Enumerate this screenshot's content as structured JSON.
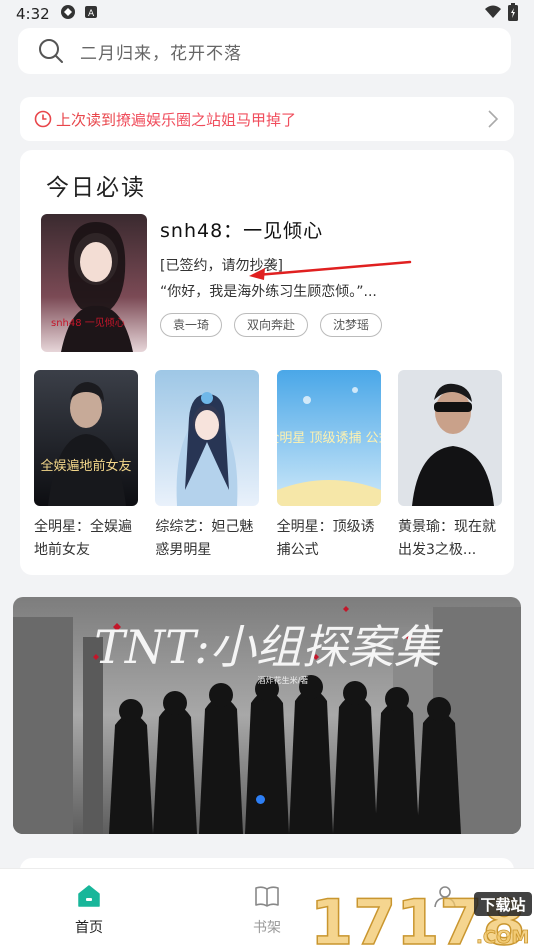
{
  "status": {
    "time": "4:32"
  },
  "search": {
    "placeholder": "二月归来，花开不落"
  },
  "last_read": {
    "prefix": "上次读到",
    "book": "撩遍娱乐圈之站姐马甲掉了"
  },
  "today": {
    "title": "今日必读",
    "feature": {
      "title": "snh48：一见倾心",
      "cover_text": "snh48 一见倾心",
      "desc1": "[已签约，请勿抄袭]",
      "desc2": "“你好，我是海外练习生顾恋倾。”...",
      "tags": [
        "袁一琦",
        "双向奔赴",
        "沈梦瑶"
      ]
    },
    "books": [
      {
        "title": "全明星：全娱遍地前女友",
        "cover_text": "全娱遍地前女友"
      },
      {
        "title": "综综艺：妲己魅惑男明星",
        "cover_text": ""
      },
      {
        "title": "全明星：顶级诱捕公式",
        "cover_text": "全明星 顶级诱捕 公式"
      },
      {
        "title": "黄景瑜：现在就出发3之极...",
        "cover_text": ""
      }
    ]
  },
  "banner": {
    "title": "TNT:小组探案集",
    "subtitle": "酒炸花生米/著"
  },
  "nav": {
    "items": [
      {
        "label": "首页"
      },
      {
        "label": "书架"
      },
      {
        "label": ""
      }
    ]
  },
  "watermark": {
    "digits": "17178",
    "site": "下载站",
    "com": ".COM"
  },
  "colors": {
    "accent_red": "#f04e5d",
    "accent_teal": "#18b69a",
    "dot_blue": "#2d7ff5"
  }
}
